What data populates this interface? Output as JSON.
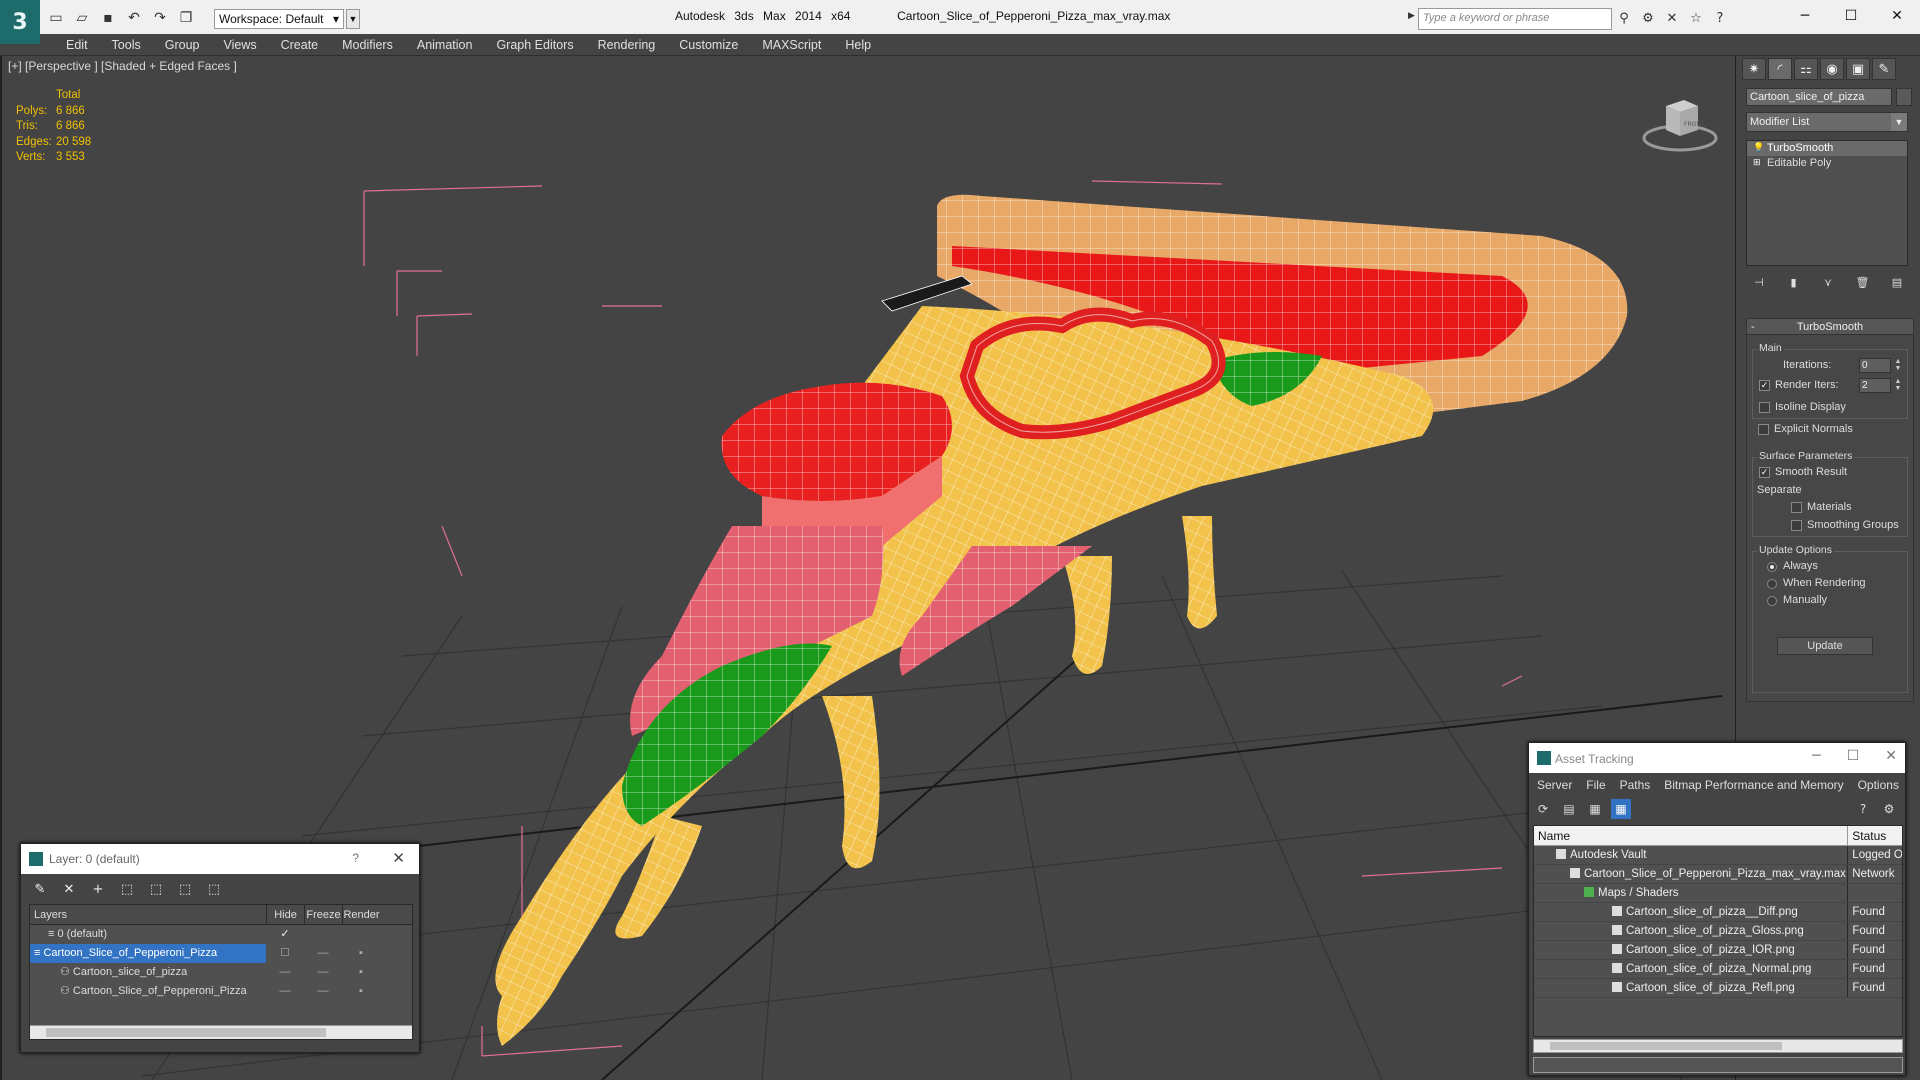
{
  "titlebar": {
    "app_name": "Autodesk 3ds Max  2014 x64",
    "file_name": "Cartoon_Slice_of_Pepperoni_Pizza_max_vray.max",
    "workspace_label": "Workspace: Default",
    "search_placeholder": "Type a keyword or phrase"
  },
  "menu": [
    "Edit",
    "Tools",
    "Group",
    "Views",
    "Create",
    "Modifiers",
    "Animation",
    "Graph Editors",
    "Rendering",
    "Customize",
    "MAXScript",
    "Help"
  ],
  "viewport": {
    "label": "[+] [Perspective ] [Shaded + Edged Faces ]",
    "stats_header": "Total",
    "stats": [
      {
        "key": "Polys:",
        "value": "6 866"
      },
      {
        "key": "Tris:",
        "value": "6 866"
      },
      {
        "key": "Edges:",
        "value": "20 598"
      },
      {
        "key": "Verts:",
        "value": "3 553"
      }
    ],
    "viewcube_label": "FRONT"
  },
  "command_panel": {
    "object_name": "Cartoon_slice_of_pizza",
    "modifier_list": "Modifier List",
    "stack": [
      {
        "label": "TurboSmooth",
        "selected": true
      },
      {
        "label": "Editable Poly",
        "selected": false
      }
    ],
    "rollout": {
      "title": "TurboSmooth",
      "main_label": "Main",
      "iterations_label": "Iterations:",
      "iterations_value": "0",
      "render_iters_label": "Render Iters:",
      "render_iters_value": "2",
      "isoline_label": "Isoline Display",
      "explicit_normals_label": "Explicit Normals",
      "surface_params_label": "Surface Parameters",
      "smooth_result_label": "Smooth Result",
      "separate_label": "Separate",
      "materials_label": "Materials",
      "smoothing_groups_label": "Smoothing Groups",
      "update_options_label": "Update Options",
      "always_label": "Always",
      "when_rendering_label": "When Rendering",
      "manually_label": "Manually",
      "update_button": "Update"
    }
  },
  "layer_panel": {
    "title": "Layer: 0 (default)",
    "help": "?",
    "columns": {
      "layers": "Layers",
      "hide": "Hide",
      "freeze": "Freeze",
      "render": "Render"
    },
    "rows": [
      {
        "name": "0 (default)",
        "indent": 1,
        "selected": false
      },
      {
        "name": "Cartoon_Slice_of_Pepperoni_Pizza",
        "indent": 0,
        "selected": true
      },
      {
        "name": "Cartoon_slice_of_pizza",
        "indent": 2,
        "selected": false
      },
      {
        "name": "Cartoon_Slice_of_Pepperoni_Pizza",
        "indent": 2,
        "selected": false
      }
    ]
  },
  "asset_panel": {
    "title": "Asset Tracking",
    "menu": [
      "Server",
      "File",
      "Paths",
      "Bitmap Performance and Memory",
      "Options"
    ],
    "columns": {
      "name": "Name",
      "status": "Status"
    },
    "rows": [
      {
        "name": "Autodesk Vault",
        "status": "Logged O",
        "indent": 1
      },
      {
        "name": "Cartoon_Slice_of_Pepperoni_Pizza_max_vray.max",
        "status": "Network",
        "indent": 2
      },
      {
        "name": "Maps / Shaders",
        "status": "",
        "indent": 3
      },
      {
        "name": "Cartoon_slice_of_pizza__Diff.png",
        "status": "Found",
        "indent": 4
      },
      {
        "name": "Cartoon_slice_of_pizza_Gloss.png",
        "status": "Found",
        "indent": 4
      },
      {
        "name": "Cartoon_slice_of_pizza_IOR.png",
        "status": "Found",
        "indent": 4
      },
      {
        "name": "Cartoon_slice_of_pizza_Normal.png",
        "status": "Found",
        "indent": 4
      },
      {
        "name": "Cartoon_slice_of_pizza_Refl.png",
        "status": "Found",
        "indent": 4
      }
    ]
  },
  "colors": {
    "accent": "#3373c3",
    "stats": "#f0c000",
    "bounding_box": "#e07090",
    "cheese": "#f2c24a",
    "sauce": "#e81818",
    "basil": "#1a9a1a",
    "crust": "#e8a868"
  }
}
